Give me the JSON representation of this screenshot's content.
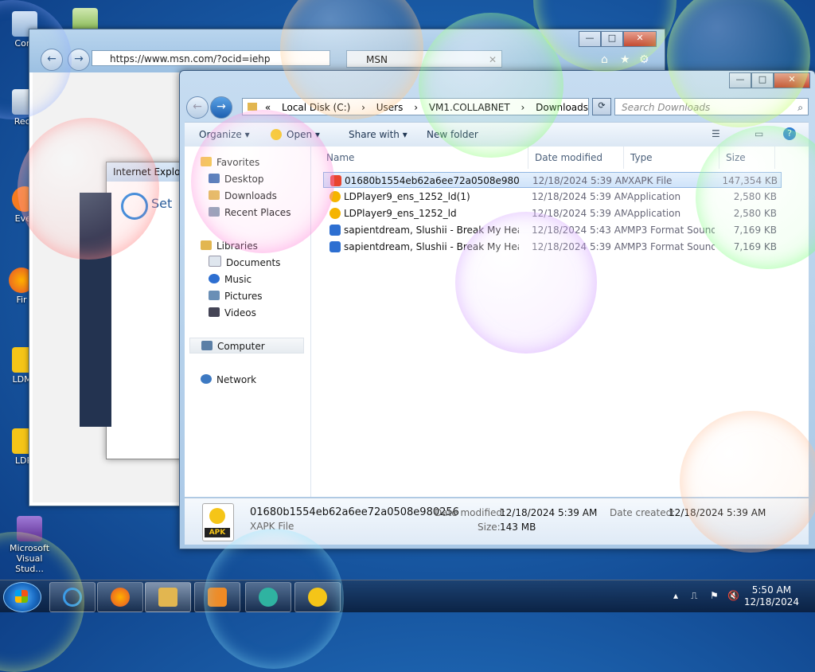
{
  "desktop": {
    "icons": [
      {
        "label": "Com"
      },
      {
        "label": "Recy"
      },
      {
        "label": "Ever"
      },
      {
        "label": "Fir"
      },
      {
        "label": "LDMu"
      },
      {
        "label": "LDPl"
      },
      {
        "label": "Microsoft Visual Stud..."
      }
    ]
  },
  "ie": {
    "url": "https://www.msn.com/?ocid=iehp",
    "tab_title": "MSN",
    "dialog_title": "Internet Explo",
    "dialog_text": "Set",
    "controls": {
      "min": "—",
      "max": "□",
      "close": "✕"
    }
  },
  "explorer": {
    "controls": {
      "min": "—",
      "max": "□",
      "close": "✕"
    },
    "breadcrumb": [
      "«",
      "Local Disk (C:)",
      "›",
      "Users",
      "›",
      "VM1.COLLABNET",
      "›",
      "Downloads"
    ],
    "search_placeholder": "Search Downloads",
    "toolbar": {
      "organize": "Organize ▾",
      "open": "Open ▾",
      "share": "Share with ▾",
      "new_folder": "New folder"
    },
    "nav": {
      "favorites": "Favorites",
      "desktop": "Desktop",
      "downloads": "Downloads",
      "recent": "Recent Places",
      "libraries": "Libraries",
      "documents": "Documents",
      "music": "Music",
      "pictures": "Pictures",
      "videos": "Videos",
      "computer": "Computer",
      "network": "Network"
    },
    "columns": {
      "name": "Name",
      "date": "Date modified",
      "type": "Type",
      "size": "Size"
    },
    "files": [
      {
        "name": "01680b1554eb62a6ee72a0508e980256",
        "date": "12/18/2024 5:39 AM",
        "type": "XAPK File",
        "size": "147,354 KB",
        "icon_color": "#e8442e"
      },
      {
        "name": "LDPlayer9_ens_1252_ld(1)",
        "date": "12/18/2024 5:39 AM",
        "type": "Application",
        "size": "2,580 KB",
        "icon_color": "#f5b400"
      },
      {
        "name": "LDPlayer9_ens_1252_ld",
        "date": "12/18/2024 5:39 AM",
        "type": "Application",
        "size": "2,580 KB",
        "icon_color": "#f5b400"
      },
      {
        "name": "sapientdream, Slushii - Break My Heart [...",
        "date": "12/18/2024 5:43 AM",
        "type": "MP3 Format Sound",
        "size": "7,169 KB",
        "icon_color": "#2d6fd1"
      },
      {
        "name": "sapientdream, Slushii - Break My Heart [...",
        "date": "12/18/2024 5:39 AM",
        "type": "MP3 Format Sound",
        "size": "7,169 KB",
        "icon_color": "#2d6fd1"
      }
    ],
    "details": {
      "filename": "01680b1554eb62a6ee72a0508e980256",
      "filetype": "XAPK File",
      "modified_label": "Date modified:",
      "modified_value": "12/18/2024 5:39 AM",
      "created_label": "Date created:",
      "created_value": "12/18/2024 5:39 AM",
      "size_label": "Size:",
      "size_value": "143 MB",
      "badge": "APK"
    }
  },
  "taskbar": {
    "clock_time": "5:50 AM",
    "clock_date": "12/18/2024"
  }
}
